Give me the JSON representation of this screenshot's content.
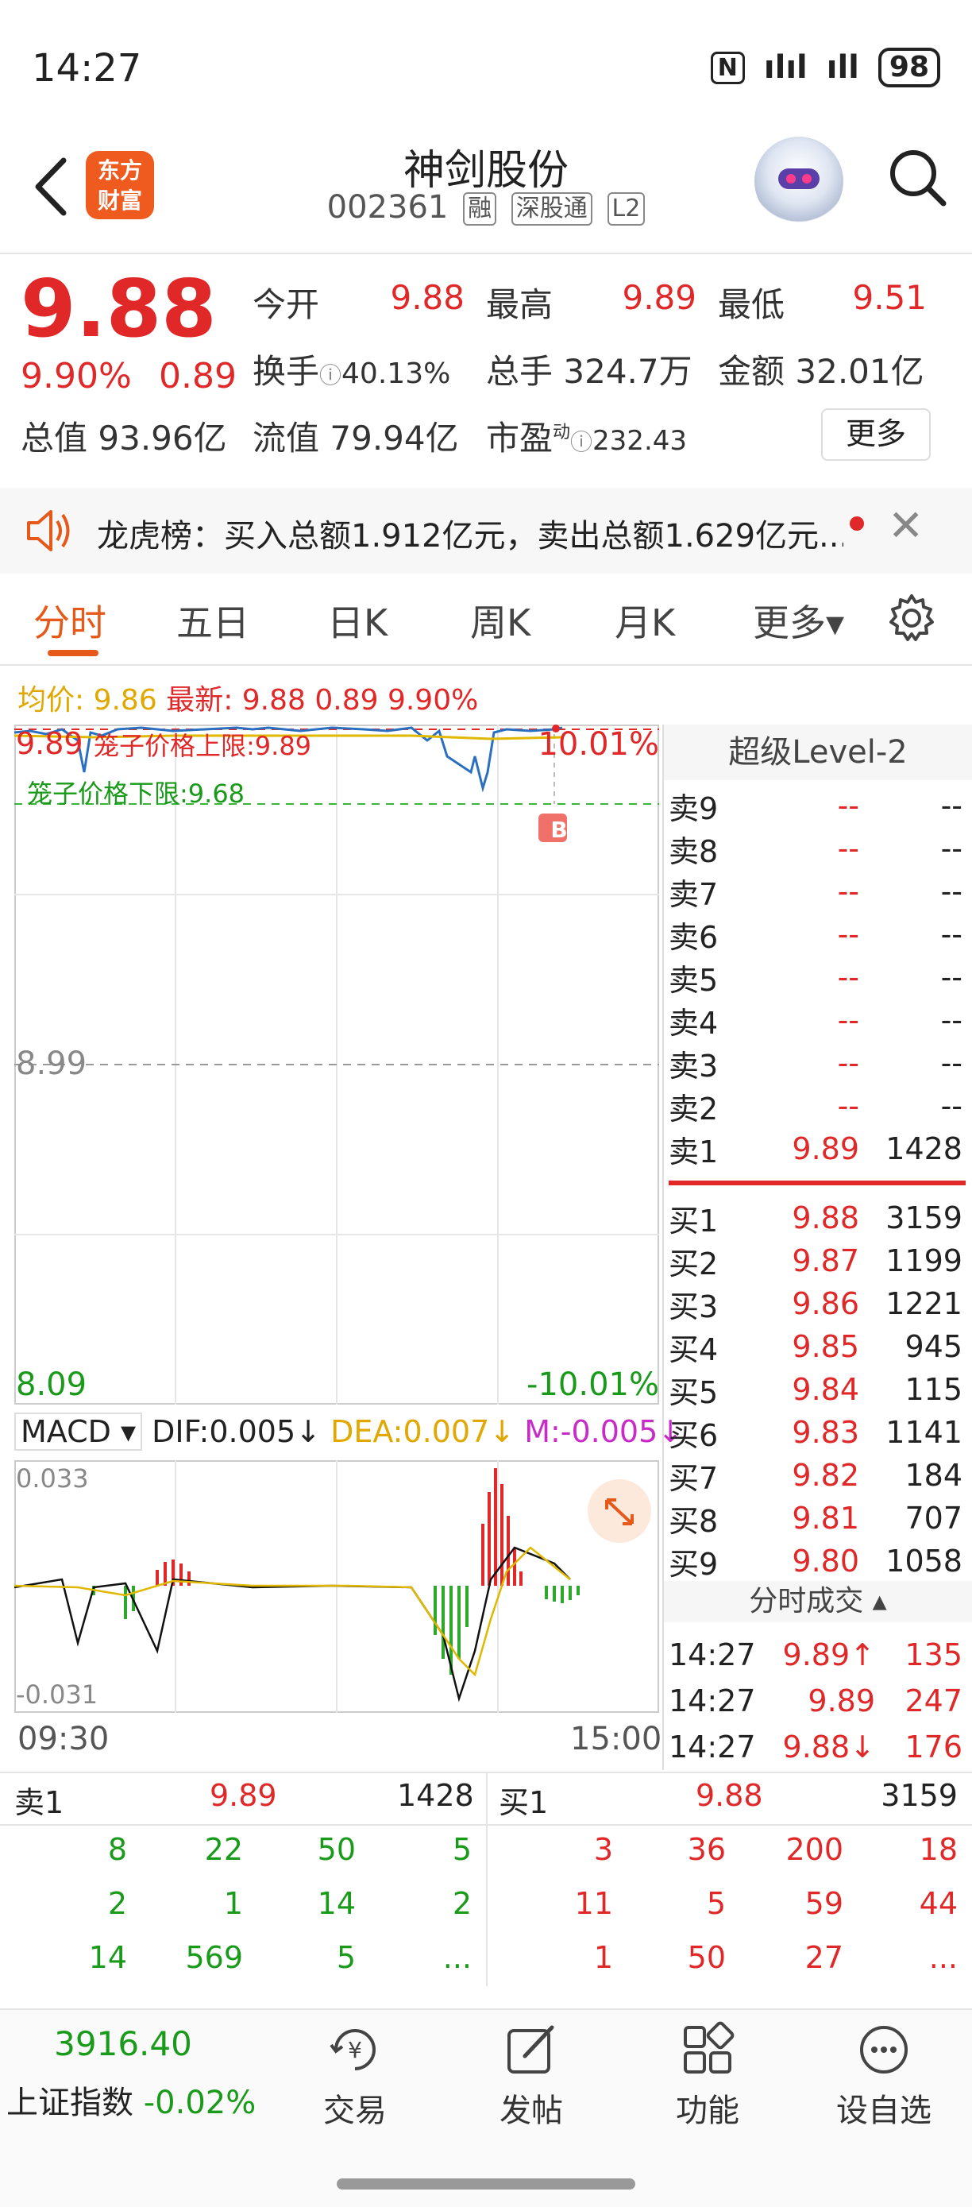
{
  "status_bar": {
    "time": "14:27",
    "nfc": "N",
    "signal1": "ılıl",
    "signal2": "ıll",
    "battery": "98"
  },
  "header": {
    "logo_line1": "东方",
    "logo_line2": "财富",
    "stock_name": "神剑股份",
    "stock_code": "002361",
    "tags": [
      "融",
      "深股通",
      "L2"
    ]
  },
  "quote": {
    "price": "9.88",
    "change_pct": "9.90%",
    "change": "0.89",
    "open_label": "今开",
    "open": "9.88",
    "high_label": "最高",
    "high": "9.89",
    "low_label": "最低",
    "low": "9.51",
    "turnover_label": "换手",
    "turnover": "40.13%",
    "volume_label": "总手",
    "volume": "324.7万",
    "amount_label": "金额",
    "amount": "32.01亿",
    "mktcap_label": "总值",
    "mktcap": "93.96亿",
    "float_label": "流值",
    "float": "79.94亿",
    "pe_label": "市盈",
    "pe_sup": "动",
    "pe": "232.43",
    "more": "更多"
  },
  "notice": {
    "text": "龙虎榜：买入总额1.912亿元，卖出总额1.629亿元..."
  },
  "tabs": [
    "分时",
    "五日",
    "日K",
    "周K",
    "月K",
    "更多▾"
  ],
  "chart": {
    "avg_label": "均价: 9.86",
    "latest_label": "最新: 9.88 0.89 9.90%",
    "top_price": "9.89",
    "mid_price": "8.99",
    "bottom_price": "8.09",
    "top_pct": "10.01%",
    "bottom_pct": "-10.01%",
    "cage_upper": "笼子价格上限:9.89",
    "cage_lower": "笼子价格下限:9.68",
    "b_marker": "B",
    "macd_selector": "MACD ▾",
    "dif": "DIF:0.005↓",
    "dea": "DEA:0.007↓",
    "m": "M:-0.005↓",
    "macd_top": "0.033",
    "macd_bottom": "-0.031",
    "time_start": "09:30",
    "time_end": "15:00"
  },
  "order_book": {
    "title": "超级Level-2",
    "asks": [
      {
        "label": "卖9",
        "price": "--",
        "vol": "--"
      },
      {
        "label": "卖8",
        "price": "--",
        "vol": "--"
      },
      {
        "label": "卖7",
        "price": "--",
        "vol": "--"
      },
      {
        "label": "卖6",
        "price": "--",
        "vol": "--"
      },
      {
        "label": "卖5",
        "price": "--",
        "vol": "--"
      },
      {
        "label": "卖4",
        "price": "--",
        "vol": "--"
      },
      {
        "label": "卖3",
        "price": "--",
        "vol": "--"
      },
      {
        "label": "卖2",
        "price": "--",
        "vol": "--"
      },
      {
        "label": "卖1",
        "price": "9.89",
        "vol": "1428"
      }
    ],
    "bids": [
      {
        "label": "买1",
        "price": "9.88",
        "vol": "3159"
      },
      {
        "label": "买2",
        "price": "9.87",
        "vol": "1199"
      },
      {
        "label": "买3",
        "price": "9.86",
        "vol": "1221"
      },
      {
        "label": "买4",
        "price": "9.85",
        "vol": "945"
      },
      {
        "label": "买5",
        "price": "9.84",
        "vol": "115"
      },
      {
        "label": "买6",
        "price": "9.83",
        "vol": "1141"
      },
      {
        "label": "买7",
        "price": "9.82",
        "vol": "184"
      },
      {
        "label": "买8",
        "price": "9.81",
        "vol": "707"
      },
      {
        "label": "买9",
        "price": "9.80",
        "vol": "1058"
      }
    ],
    "trades_title": "分时成交 ▴",
    "trades": [
      {
        "time": "14:27",
        "price": "9.89↑",
        "vol": "135"
      },
      {
        "time": "14:27",
        "price": "9.89",
        "vol": "247"
      },
      {
        "time": "14:27",
        "price": "9.88↓",
        "vol": "176"
      }
    ]
  },
  "queue": {
    "ask_label": "卖1",
    "ask_price": "9.89",
    "ask_vol": "1428",
    "bid_label": "买1",
    "bid_price": "9.88",
    "bid_vol": "3159",
    "ask_rows": [
      [
        "8",
        "22",
        "50",
        "5"
      ],
      [
        "2",
        "1",
        "14",
        "2"
      ],
      [
        "14",
        "569",
        "5",
        "..."
      ]
    ],
    "bid_rows": [
      [
        "3",
        "36",
        "200",
        "18"
      ],
      [
        "11",
        "5",
        "59",
        "44"
      ],
      [
        "1",
        "50",
        "27",
        "..."
      ]
    ]
  },
  "bottom_nav": {
    "index_value": "3916.40",
    "index_name": "上证指数",
    "index_change": "-0.02%",
    "items": [
      "交易",
      "发帖",
      "功能",
      "设自选"
    ]
  }
}
